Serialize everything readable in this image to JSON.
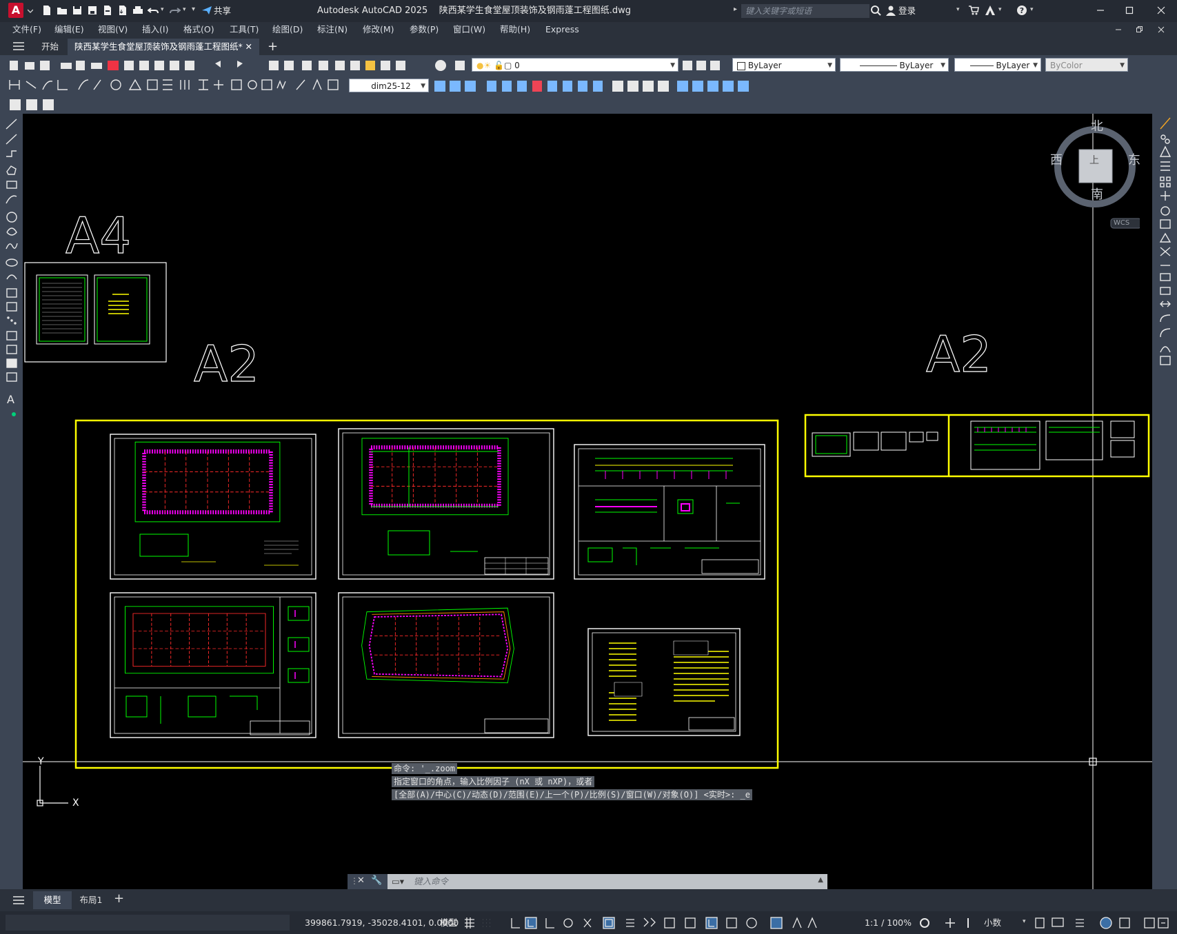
{
  "app": {
    "logo": "A",
    "window_title": "Autodesk AutoCAD 2025",
    "file_title": "陕西某学生食堂屋顶装饰及钢雨蓬工程图纸.dwg",
    "share_label": "共享",
    "search_placeholder": "键入关键字或短语",
    "login_label": "登录"
  },
  "menu": [
    "文件(F)",
    "编辑(E)",
    "视图(V)",
    "插入(I)",
    "格式(O)",
    "工具(T)",
    "绘图(D)",
    "标注(N)",
    "修改(M)",
    "参数(P)",
    "窗口(W)",
    "帮助(H)",
    "Express"
  ],
  "tabs": {
    "start": "开始",
    "active": "陕西某学生食堂屋顶装饰及钢雨蓬工程图纸*",
    "add": "+"
  },
  "toolbar": {
    "layer": "0",
    "color": "ByLayer",
    "linetype": "ByLayer",
    "lineweight": "ByLayer",
    "plotstyle": "ByColor",
    "dimstyle": "dim25-12"
  },
  "viewcube": {
    "north": "北",
    "south": "南",
    "east": "东",
    "west": "西",
    "face": "上",
    "wcs": "WCS"
  },
  "drawing": {
    "label_a4": "A4",
    "label_a2_left": "A2",
    "label_a2_right": "A2",
    "ucs_x": "X",
    "ucs_y": "Y"
  },
  "command": {
    "history": [
      "命令: '_.zoom",
      "指定窗口的角点，输入比例因子 (nX 或 nXP)，或者",
      "[全部(A)/中心(C)/动态(D)/范围(E)/上一个(P)/比例(S)/窗口(W)/对象(O)] <实时>: _e"
    ],
    "placeholder": "键入命令"
  },
  "layout_tabs": [
    "模型",
    "布局1"
  ],
  "status": {
    "coords": "399861.7919, -35028.4101, 0.0000",
    "space": "模型",
    "scale": "1:1 / 100%",
    "units": "小数"
  },
  "colors": {
    "canvas": "#000000",
    "frame_yellow": "#ffff00",
    "grid_red": "#ff2a2a",
    "axis_green": "#00ff00",
    "hatch_magenta": "#ff00ff",
    "ui_dark": "#252a33",
    "ui_mid": "#3c4554"
  }
}
